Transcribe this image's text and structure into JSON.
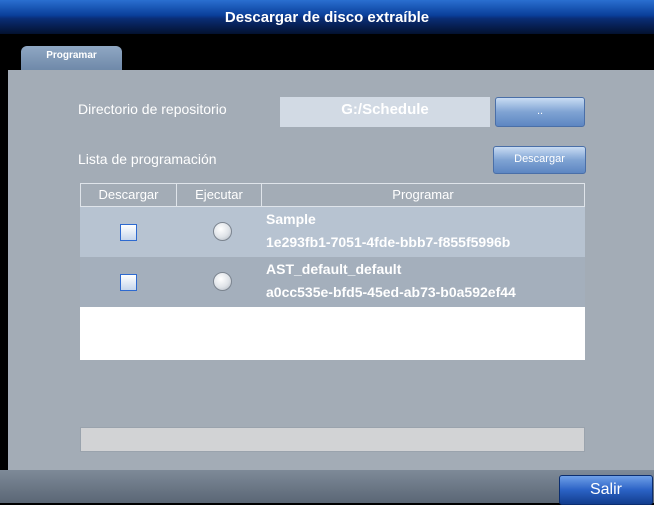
{
  "window": {
    "title": "Descargar de  disco extraíble"
  },
  "tabs": [
    {
      "label": "Programar"
    }
  ],
  "repository": {
    "label": "Directorio de repositorio",
    "path": "G:/Schedule",
    "browse_label": ".."
  },
  "schedule_list": {
    "label": "Lista de programación",
    "download_button": "Descargar",
    "columns": [
      "Descargar",
      "Ejecutar",
      "Programar"
    ],
    "rows": [
      {
        "name": "Sample",
        "id": "1e293fb1-7051-4fde-bbb7-f855f5996b",
        "download_checked": false,
        "run_selected": false
      },
      {
        "name": "AST_default_default",
        "id": "a0cc535e-bfd5-45ed-ab73-b0a592ef44",
        "download_checked": false,
        "run_selected": false
      }
    ]
  },
  "status": {
    "text": ""
  },
  "footer": {
    "exit_label": "Salir"
  }
}
